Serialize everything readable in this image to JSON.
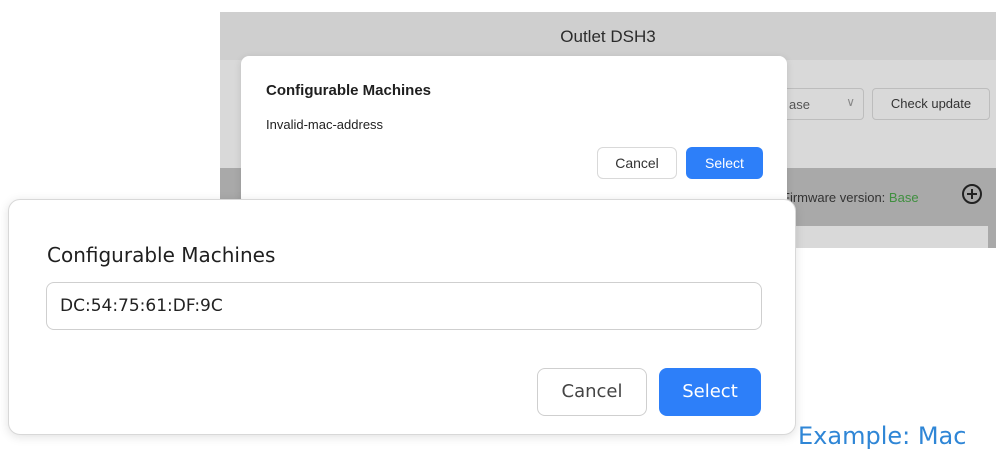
{
  "background_window": {
    "title": "Outlet DSH3",
    "version_select_value": "ase",
    "check_update_label": "Check update",
    "firmware_label": "Firmware version:",
    "firmware_value": "Base"
  },
  "small_dialog": {
    "title": "Configurable Machines",
    "value": "Invalid-mac-address",
    "cancel_label": "Cancel",
    "select_label": "Select"
  },
  "large_dialog": {
    "title": "Configurable Machines",
    "input_value": "DC:54:75:61:DF:9C",
    "cancel_label": "Cancel",
    "select_label": "Select"
  },
  "example_link": "Example: Mac",
  "colors": {
    "accent": "#2d7ff9",
    "firmware_value": "#3f8f3f",
    "link": "#2f86d6"
  },
  "icons": [
    "chevron-down-icon",
    "plus-circle-icon"
  ]
}
